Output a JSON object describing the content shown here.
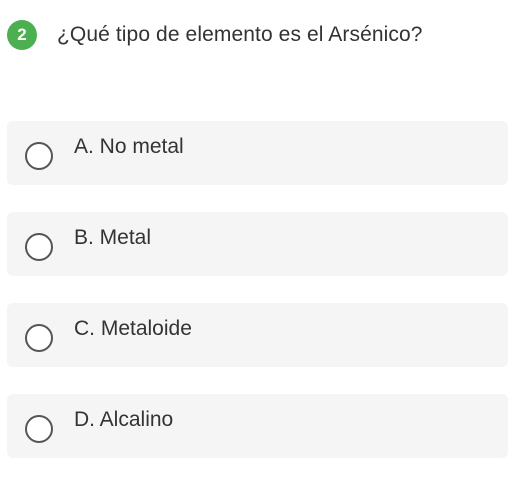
{
  "question": {
    "number": "2",
    "text": "¿Qué tipo de elemento es el Arsénico?"
  },
  "options": [
    {
      "label": "A. No metal",
      "selected": false
    },
    {
      "label": "B. Metal",
      "selected": false
    },
    {
      "label": "C. Metaloide",
      "selected": false
    },
    {
      "label": "D. Alcalino",
      "selected": false
    }
  ],
  "colors": {
    "badge": "#4caf50",
    "option_background": "#f5f5f5",
    "text": "#333333"
  }
}
